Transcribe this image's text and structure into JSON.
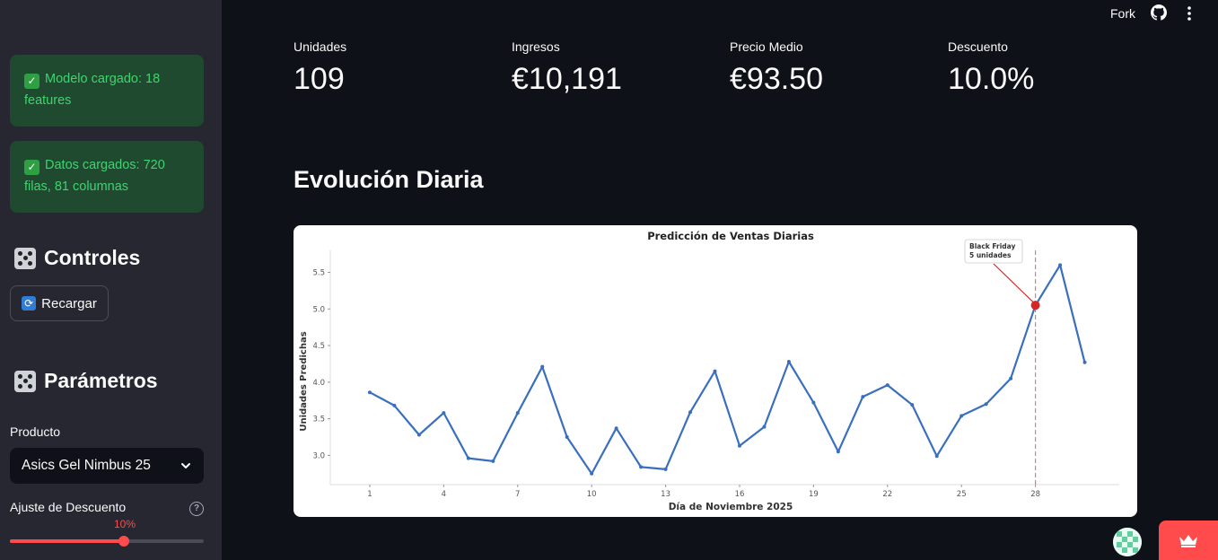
{
  "header": {
    "fork_label": "Fork"
  },
  "sidebar": {
    "alerts": [
      {
        "text": "Modelo cargado: 18 features"
      },
      {
        "text": "Datos cargados: 720 filas, 81 columnas"
      }
    ],
    "controls_title": "Controles",
    "reload_label": "Recargar",
    "params_title": "Parámetros",
    "product_label": "Producto",
    "product_value": "Asics Gel Nimbus 25",
    "discount_label": "Ajuste de Descuento",
    "discount_value": "10%",
    "discount_fraction": 0.59
  },
  "metrics": [
    {
      "label": "Unidades",
      "value": "109"
    },
    {
      "label": "Ingresos",
      "value": "€10,191"
    },
    {
      "label": "Precio Medio",
      "value": "€93.50"
    },
    {
      "label": "Descuento",
      "value": "10.0%"
    }
  ],
  "section_title": "Evolución Diaria",
  "colors": {
    "accent": "#ff4b4b",
    "success_bg": "#1f4a30",
    "success_text": "#3dd56d",
    "line": "#3a6fbf",
    "marker": "#d62728"
  },
  "chart_data": {
    "type": "line",
    "title": "Predicción de Ventas Diarias",
    "xlabel": "Día de Noviembre 2025",
    "ylabel": "Unidades Predichas",
    "xlim": [
      -0.6,
      31.4
    ],
    "ylim": [
      2.6,
      5.8
    ],
    "xticks": [
      1,
      4,
      7,
      10,
      13,
      16,
      19,
      22,
      25,
      28
    ],
    "yticks": [
      3.0,
      3.5,
      4.0,
      4.5,
      5.0,
      5.5
    ],
    "ytick_labels": [
      "3.0",
      "3.5",
      "4.0",
      "4.5",
      "5.0",
      "5.5"
    ],
    "x": [
      1,
      2,
      3,
      4,
      5,
      6,
      7,
      8,
      9,
      10,
      11,
      12,
      13,
      14,
      15,
      16,
      17,
      18,
      19,
      20,
      21,
      22,
      23,
      24,
      25,
      26,
      27,
      28,
      29,
      30
    ],
    "series": [
      {
        "values": [
          3.86,
          3.68,
          3.28,
          3.58,
          2.96,
          2.92,
          3.58,
          4.21,
          3.25,
          2.75,
          3.37,
          2.84,
          2.81,
          3.59,
          4.15,
          3.13,
          3.39,
          4.28,
          3.72,
          3.05,
          3.8,
          3.96,
          3.69,
          2.99,
          3.54,
          3.7,
          4.05,
          5.05,
          5.6,
          4.27
        ]
      }
    ],
    "annotation": {
      "x": 28,
      "y": 5.05,
      "line1": "Black Friday",
      "line2": "5 unidades"
    },
    "grid": false
  }
}
